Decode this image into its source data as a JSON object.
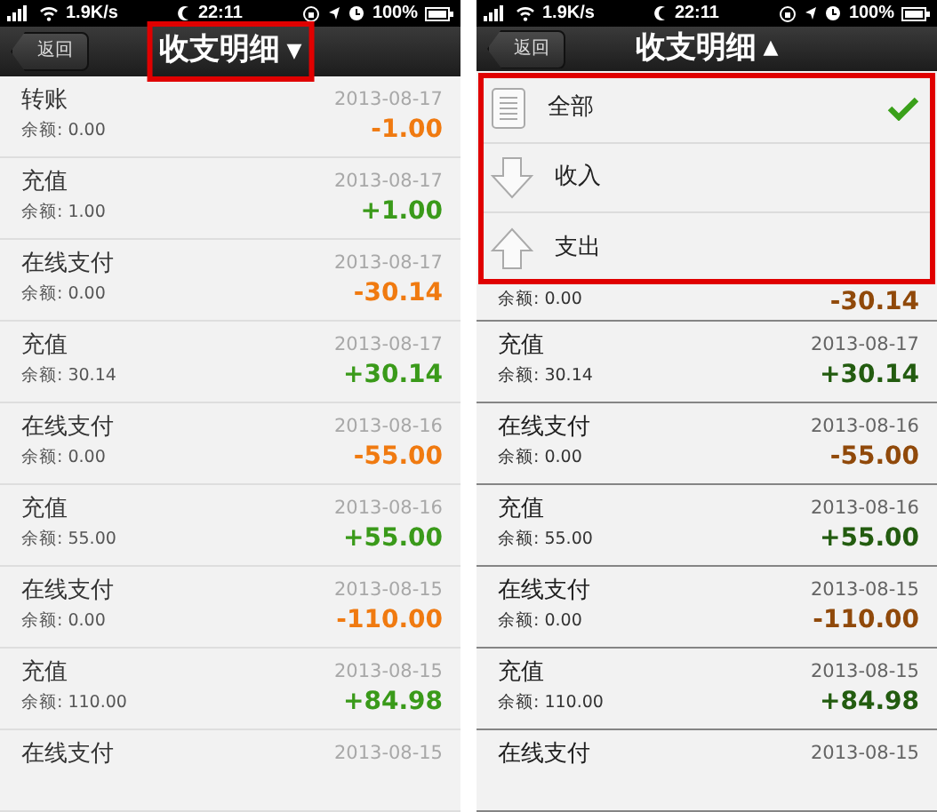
{
  "panels": [
    {
      "status_bar": {
        "speed": "1.9K/s",
        "time": "22:11",
        "battery": "100%"
      },
      "nav": {
        "back": "返回",
        "title": "收支明细",
        "caret": "▼",
        "highlighted": true
      },
      "dimmed": false,
      "rows": [
        {
          "title": "转账",
          "balance": "余额: 0.00",
          "date": "2013-08-17",
          "amount": "-1.00",
          "kind": "expense"
        },
        {
          "title": "充值",
          "balance": "余额: 1.00",
          "date": "2013-08-17",
          "amount": "+1.00",
          "kind": "income"
        },
        {
          "title": "在线支付",
          "balance": "余额: 0.00",
          "date": "2013-08-17",
          "amount": "-30.14",
          "kind": "expense"
        },
        {
          "title": "充值",
          "balance": "余额: 30.14",
          "date": "2013-08-17",
          "amount": "+30.14",
          "kind": "income"
        },
        {
          "title": "在线支付",
          "balance": "余额: 0.00",
          "date": "2013-08-16",
          "amount": "-55.00",
          "kind": "expense"
        },
        {
          "title": "充值",
          "balance": "余额: 55.00",
          "date": "2013-08-16",
          "amount": "+55.00",
          "kind": "income"
        },
        {
          "title": "在线支付",
          "balance": "余额: 0.00",
          "date": "2013-08-15",
          "amount": "-110.00",
          "kind": "expense"
        },
        {
          "title": "充值",
          "balance": "余额: 110.00",
          "date": "2013-08-15",
          "amount": "+84.98",
          "kind": "income"
        },
        {
          "title": "在线支付",
          "date": "2013-08-15"
        }
      ]
    },
    {
      "status_bar": {
        "speed": "1.9K/s",
        "time": "22:11",
        "battery": "100%"
      },
      "nav": {
        "back": "返回",
        "title": "收支明细",
        "caret": "▲",
        "highlighted": false
      },
      "menu": {
        "highlighted": true,
        "items": [
          {
            "label": "全部",
            "kind": "all",
            "selected": true
          },
          {
            "label": "收入",
            "kind": "income",
            "selected": false
          },
          {
            "label": "支出",
            "kind": "expense",
            "selected": false
          }
        ]
      },
      "dimmed": true,
      "rows": [
        {
          "balance": "余额: 0.00",
          "amount": "-30.14",
          "kind": "expense"
        },
        {
          "title": "充值",
          "balance": "余额: 30.14",
          "date": "2013-08-17",
          "amount": "+30.14",
          "kind": "income"
        },
        {
          "title": "在线支付",
          "balance": "余额: 0.00",
          "date": "2013-08-16",
          "amount": "-55.00",
          "kind": "expense"
        },
        {
          "title": "充值",
          "balance": "余额: 55.00",
          "date": "2013-08-16",
          "amount": "+55.00",
          "kind": "income"
        },
        {
          "title": "在线支付",
          "balance": "余额: 0.00",
          "date": "2013-08-15",
          "amount": "-110.00",
          "kind": "expense"
        },
        {
          "title": "充值",
          "balance": "余额: 110.00",
          "date": "2013-08-15",
          "amount": "+84.98",
          "kind": "income"
        },
        {
          "title": "在线支付",
          "date": "2013-08-15"
        }
      ]
    }
  ]
}
